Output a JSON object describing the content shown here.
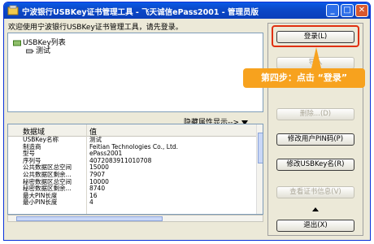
{
  "window": {
    "title": "宁波银行USBKey证书管理工具 - 飞天诚信ePass2001 - 管理员版",
    "controls": {
      "minimize": "_",
      "maximize": "□",
      "close": "✕"
    },
    "title_color": "#0a4fd2"
  },
  "welcome_text": "欢迎使用宁波银行USBKey证书管理工具，请先登录。",
  "tree": {
    "root_label": "USBKey列表",
    "child_label": "测试",
    "root_icon": "usbkey-list-icon",
    "child_icon": "usbkey-icon"
  },
  "attr_toggle_label": "隐藏属性显示-->",
  "grid": {
    "headers": [
      "数据域",
      "值"
    ],
    "rows": [
      [
        "USBKey名称",
        "测试"
      ],
      [
        "制造商",
        "Feitian Technologies Co., Ltd."
      ],
      [
        "型号",
        "ePass2001"
      ],
      [
        "序列号",
        "4072083911010708"
      ],
      [
        "公共数据区总空间",
        "15000"
      ],
      [
        "公共数据区剩余...",
        "7907"
      ],
      [
        "秘密数据区总空间",
        "10000"
      ],
      [
        "秘密数据区剩余...",
        "8740"
      ],
      [
        "最大PIN长度",
        "16"
      ],
      [
        "最小PIN长度",
        "4"
      ]
    ]
  },
  "buttons": {
    "login": "登录(L)",
    "import": "导入",
    "delete": "删除...(D)",
    "change_pin": "修改用户PIN码(P)",
    "rename": "修改USBKey名(R)",
    "cert_info": "查看证书信息(V)",
    "exit": "退出(X)"
  },
  "annotation": {
    "text": "第四步：点击 “登录”",
    "callout_color": "#f7a21e",
    "highlight_color": "#e03010"
  }
}
